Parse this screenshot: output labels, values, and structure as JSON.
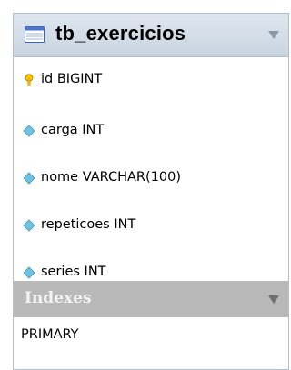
{
  "table": {
    "name": "tb_exercicios",
    "icon": "table-icon",
    "columns": [
      {
        "label": "id BIGINT",
        "icon": "primary-key-icon"
      },
      {
        "label": "carga INT",
        "icon": "column-diamond-icon"
      },
      {
        "label": "nome VARCHAR(100)",
        "icon": "column-diamond-icon"
      },
      {
        "label": "repeticoes INT",
        "icon": "column-diamond-icon"
      },
      {
        "label": "series INT",
        "icon": "column-diamond-icon"
      }
    ]
  },
  "indexes": {
    "title": "Indexes",
    "items": [
      "PRIMARY"
    ]
  },
  "colors": {
    "header_bg": "#c9d4e0",
    "indexes_bg": "#b9b9b9",
    "key_icon": "#f2c200",
    "diamond_icon": "#6fc3e0"
  }
}
